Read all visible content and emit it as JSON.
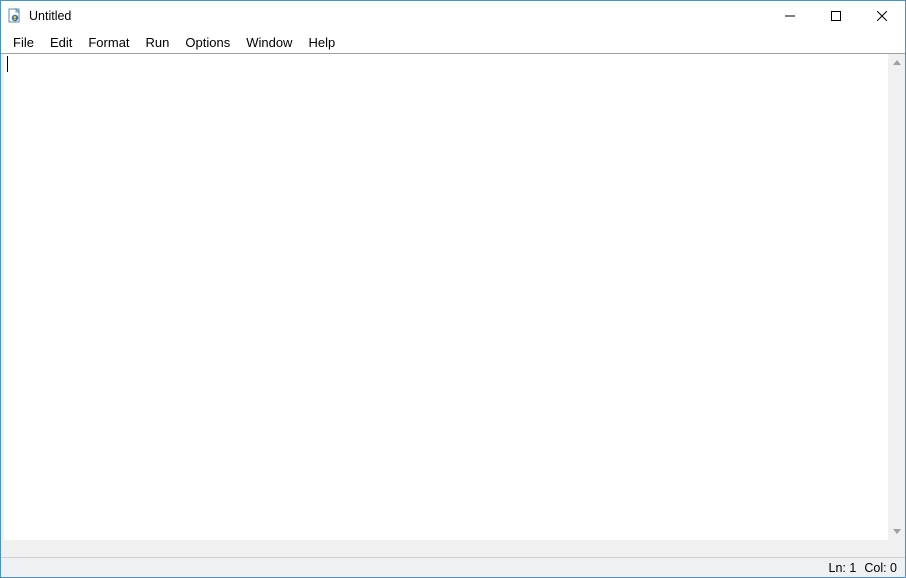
{
  "window": {
    "title": "Untitled"
  },
  "menu": {
    "items": [
      "File",
      "Edit",
      "Format",
      "Run",
      "Options",
      "Window",
      "Help"
    ]
  },
  "editor": {
    "content": ""
  },
  "status": {
    "line_label": "Ln: 1",
    "col_label": "Col: 0"
  }
}
